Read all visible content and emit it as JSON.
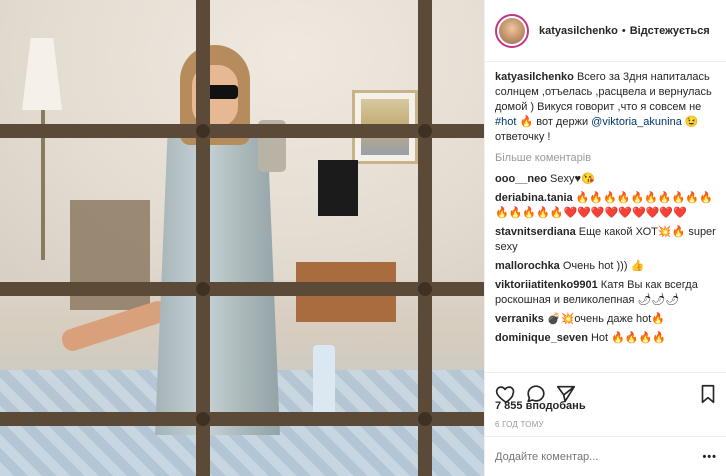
{
  "post": {
    "username": "katyasilchenko",
    "follow_status": "Відстежується",
    "dot": "•",
    "caption_text": "Всего за 3дня напиталась солнцем ,отъелась ,расцвела и вернулась домой ) Викуся говорит ,что я совсем не",
    "caption_hashtag": "#hot",
    "caption_text2": "🔥 вот держи",
    "caption_mention": "@viktoria_akunina",
    "caption_text3": "😉 ответочку !",
    "more_comments": "Більше коментарів",
    "likes": "7 855 вподобань",
    "time_ago": "6 ГОД ТОМУ",
    "add_comment_placeholder": "Додайте коментар...",
    "options": "•••"
  },
  "comments": [
    {
      "user": "ooo__neo",
      "text": "Sexy♥😘"
    },
    {
      "user": "deriabina.tania",
      "text": "🔥🔥🔥🔥🔥🔥🔥🔥🔥🔥🔥🔥🔥🔥🔥❤️❤️❤️❤️❤️❤️❤️❤️❤️"
    },
    {
      "user": "stavnitserdiana",
      "text": "Еще какой ХОТ💥🔥 super sexy"
    },
    {
      "user": "mallorochka",
      "text": "Очень hot ))) 👍"
    },
    {
      "user": "viktoriiatitenko9901",
      "text": "Катя Вы как всегда роскошная и великолепная 🌶🌶🌶"
    },
    {
      "user": "verraniks",
      "text": "💣💥очень даже hot🔥"
    },
    {
      "user": "dominique_seven",
      "text": "Hot 🔥🔥🔥🔥"
    }
  ],
  "icons": {
    "like": "heart-icon",
    "comment": "comment-icon",
    "share": "share-icon",
    "save": "bookmark-icon"
  }
}
